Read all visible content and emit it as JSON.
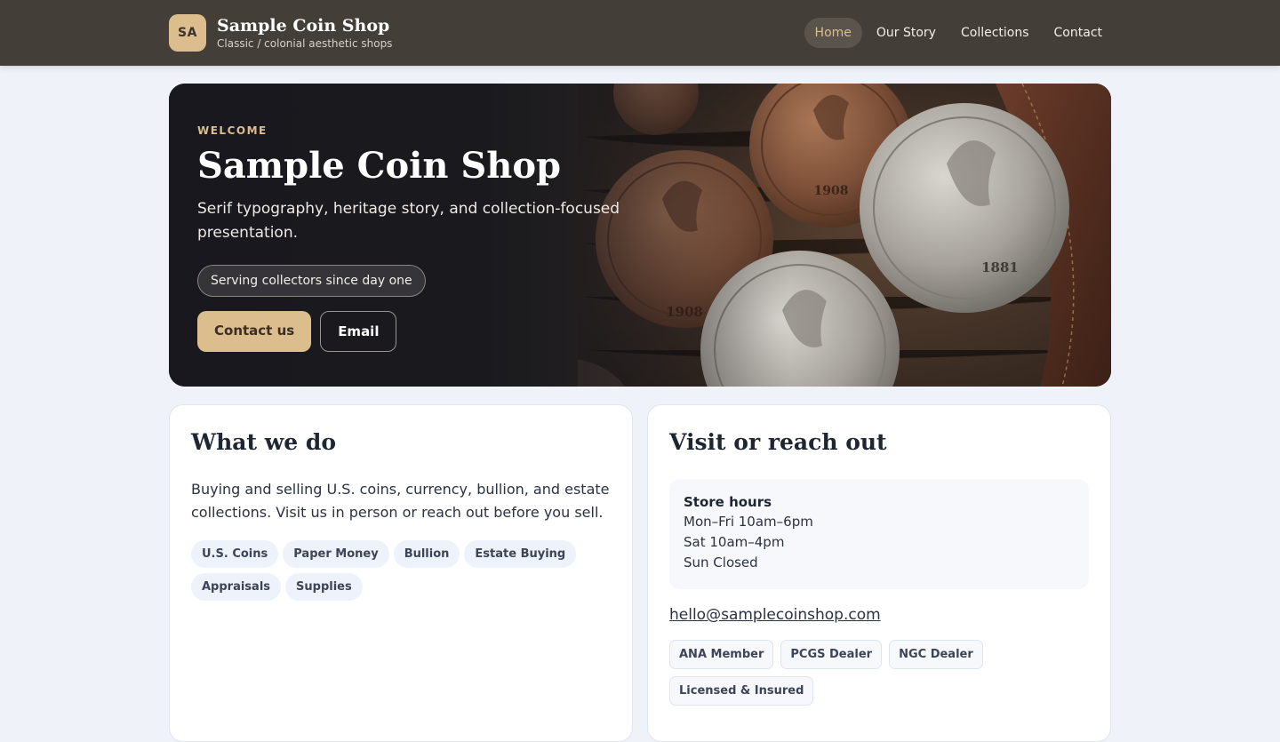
{
  "header": {
    "logo_text": "SA",
    "brand_name": "Sample Coin Shop",
    "tagline": "Classic / colonial aesthetic shops",
    "nav": [
      {
        "label": "Home",
        "active": true
      },
      {
        "label": "Our Story"
      },
      {
        "label": "Collections"
      },
      {
        "label": "Contact"
      }
    ]
  },
  "hero": {
    "eyebrow": "WELCOME",
    "title": "Sample Coin Shop",
    "subtitle": "Serif typography, heritage story, and collection-focused presentation.",
    "pill": "Serving collectors since day one",
    "primary_button": "Contact us",
    "secondary_button": "Email",
    "coin_years": [
      "1908",
      "1908",
      "1881"
    ]
  },
  "what_we_do": {
    "title": "What we do",
    "text": "Buying and selling U.S. coins, currency, bullion, and estate collections. Visit us in person or reach out before you sell.",
    "tags": [
      "U.S. Coins",
      "Paper Money",
      "Bullion",
      "Estate Buying",
      "Appraisals",
      "Supplies"
    ]
  },
  "visit": {
    "title": "Visit or reach out",
    "hours_title": "Store hours",
    "hours": [
      "Mon–Fri 10am–6pm",
      "Sat 10am–4pm",
      "Sun Closed"
    ],
    "email": "hello@samplecoinshop.com",
    "badges": [
      "ANA Member",
      "PCGS Dealer",
      "NGC Dealer",
      "Licensed & Insured"
    ]
  },
  "colors": {
    "header_bg": "#433e38",
    "accent": "#dcbd8e",
    "page_bg": "#eff3f9"
  }
}
